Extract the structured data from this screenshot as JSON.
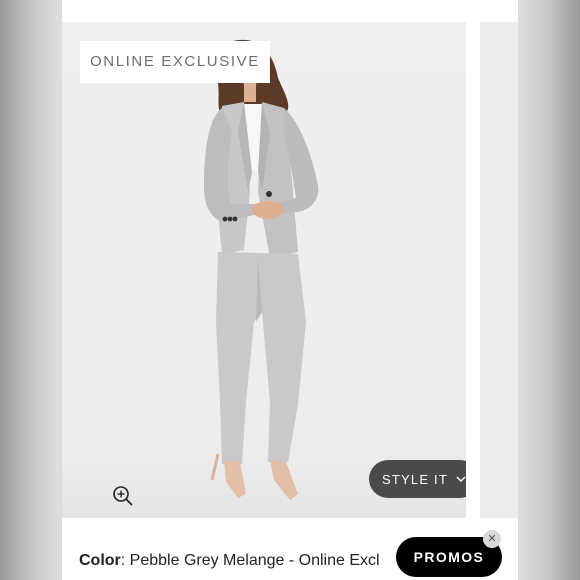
{
  "badge": {
    "text": "ONLINE EXCLUSIVE"
  },
  "style_button": {
    "label": "STYLE IT",
    "icon": "chevron-down-icon"
  },
  "zoom": {
    "icon": "zoom-in-icon"
  },
  "product": {
    "color_label": "Color",
    "color_value": ": Pebble Grey Melange - Online Exclusive"
  },
  "promos": {
    "label": "PROMOS",
    "close_icon": "close-icon",
    "close_glyph": "✕"
  },
  "colors": {
    "suit": "#c7c7c9",
    "promo_bg": "#000000",
    "style_bg": "#4a4a4a"
  }
}
